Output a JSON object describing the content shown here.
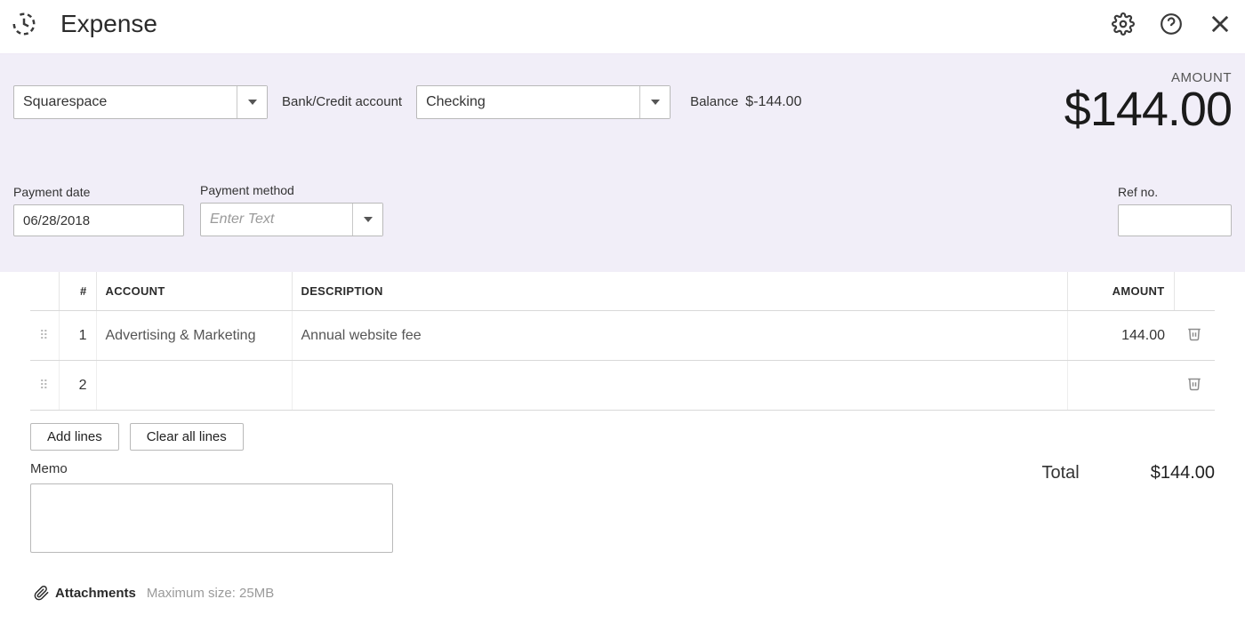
{
  "header": {
    "title": "Expense"
  },
  "payee": {
    "value": "Squarespace"
  },
  "account_label": "Bank/Credit account",
  "account": {
    "value": "Checking"
  },
  "balance": {
    "label": "Balance",
    "value": "$-144.00"
  },
  "amount": {
    "label": "AMOUNT",
    "value": "$144.00"
  },
  "fields": {
    "payment_date": {
      "label": "Payment date",
      "value": "06/28/2018"
    },
    "payment_method": {
      "label": "Payment method",
      "placeholder": "Enter Text",
      "value": ""
    },
    "ref_no": {
      "label": "Ref no.",
      "value": ""
    }
  },
  "columns": {
    "num": "#",
    "account": "ACCOUNT",
    "description": "DESCRIPTION",
    "amount": "AMOUNT"
  },
  "lines": [
    {
      "num": "1",
      "account": "Advertising & Marketing",
      "description": "Annual website fee",
      "amount": "144.00"
    },
    {
      "num": "2",
      "account": "",
      "description": "",
      "amount": ""
    }
  ],
  "buttons": {
    "add_lines": "Add lines",
    "clear_all": "Clear all lines"
  },
  "memo": {
    "label": "Memo",
    "value": ""
  },
  "total": {
    "label": "Total",
    "value": "$144.00"
  },
  "attachments": {
    "label": "Attachments",
    "hint": "Maximum size: 25MB"
  }
}
